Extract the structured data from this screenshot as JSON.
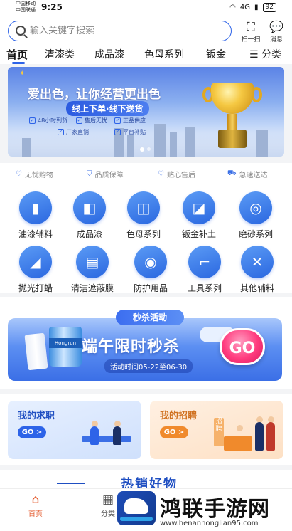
{
  "status_bar": {
    "carrier_1": "中国移动",
    "carrier_2": "中国联通",
    "time": "9:25",
    "network": "4G",
    "battery": "92"
  },
  "search": {
    "placeholder": "输入关键字搜索",
    "scan_label": "扫一扫",
    "message_label": "消息"
  },
  "tabs": {
    "items": [
      "首页",
      "清漆类",
      "成品漆",
      "色母系列",
      "钣金"
    ],
    "menu_label": "分类"
  },
  "banner": {
    "headline": "爱出色，让你经营更出色",
    "subline": "线上下单·线下送货",
    "features": [
      "48小时到货",
      "售后无忧",
      "正品供应",
      "厂家直销",
      "平台补贴"
    ],
    "active_slide": 1,
    "slide_count": 2
  },
  "guarantees": [
    "无忧购物",
    "品质保障",
    "贴心售后",
    "急速送达"
  ],
  "categories": [
    {
      "label": "油漆辅料",
      "icon": "bottle-icon"
    },
    {
      "label": "成品漆",
      "icon": "paint-bucket-icon"
    },
    {
      "label": "色母系列",
      "icon": "cup-icon"
    },
    {
      "label": "钣金补土",
      "icon": "car-door-icon"
    },
    {
      "label": "磨砂系列",
      "icon": "sanding-disc-icon"
    },
    {
      "label": "抛光打蜡",
      "icon": "polisher-icon"
    },
    {
      "label": "清洁遮蔽膜",
      "icon": "film-roll-icon"
    },
    {
      "label": "防护用品",
      "icon": "gas-mask-icon"
    },
    {
      "label": "工具系列",
      "icon": "spray-gun-icon"
    },
    {
      "label": "其他辅料",
      "icon": "tools-icon"
    }
  ],
  "promo": {
    "tag": "秒杀活动",
    "title": "端午限时秒杀",
    "date": "活动时间05-22至06-30",
    "go": "GO",
    "product_brand": "Hongrun"
  },
  "jobs": {
    "seek_title": "我的求职",
    "hire_title": "我的招聘",
    "go": "GO >",
    "board_text": "招聘"
  },
  "hot_title": "热销好物",
  "bottom_nav": [
    {
      "label": "首页",
      "icon": "home-icon",
      "active": true
    },
    {
      "label": "分类",
      "icon": "grid-icon",
      "active": false
    }
  ],
  "watermark": {
    "text": "鸿联手游网",
    "url": "www.henanhonglian95.com"
  },
  "colors": {
    "accent": "#2d63e8",
    "promo_go": "#ff3b7e",
    "hire_accent": "#f08a2c",
    "nav_active": "#e45a2c"
  }
}
